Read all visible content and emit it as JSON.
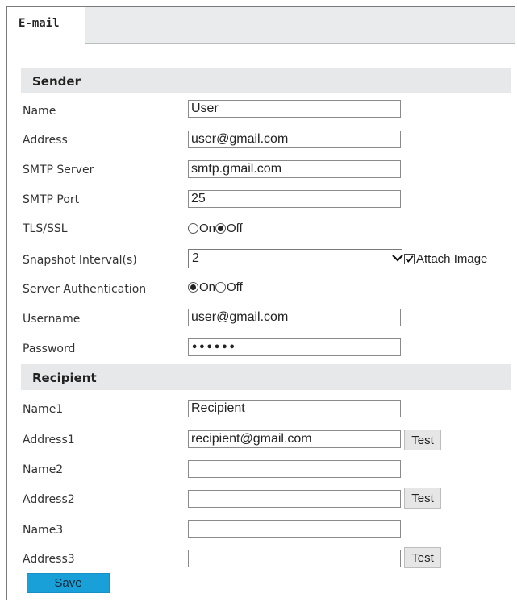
{
  "tab": {
    "label": "E-mail"
  },
  "sender": {
    "heading": "Sender",
    "name_label": "Name",
    "name_value": "User",
    "address_label": "Address",
    "address_value": "user@gmail.com",
    "smtp_server_label": "SMTP Server",
    "smtp_server_value": "smtp.gmail.com",
    "smtp_port_label": "SMTP Port",
    "smtp_port_value": "25",
    "tls_label": "TLS/SSL",
    "tls_on_label": "On",
    "tls_off_label": "Off",
    "tls_selected": "Off",
    "snapshot_label": "Snapshot Interval(s)",
    "snapshot_value": "2",
    "attach_image_label": "Attach Image",
    "attach_image_checked": true,
    "auth_label": "Server Authentication",
    "auth_on_label": "On",
    "auth_off_label": "Off",
    "auth_selected": "On",
    "username_label": "Username",
    "username_value": "user@gmail.com",
    "password_label": "Password",
    "password_value": "••••••"
  },
  "recipient": {
    "heading": "Recipient",
    "name1_label": "Name1",
    "name1_value": "Recipient",
    "address1_label": "Address1",
    "address1_value": "recipient@gmail.com",
    "name2_label": "Name2",
    "name2_value": "",
    "address2_label": "Address2",
    "address2_value": "",
    "name3_label": "Name3",
    "name3_value": "",
    "address3_label": "Address3",
    "address3_value": "",
    "test_label": "Test"
  },
  "save_label": "Save",
  "colors": {
    "save_button": "#1aa0d8",
    "section_bg": "#e6e8ea",
    "tab_bar_bg": "#e9ebed"
  }
}
